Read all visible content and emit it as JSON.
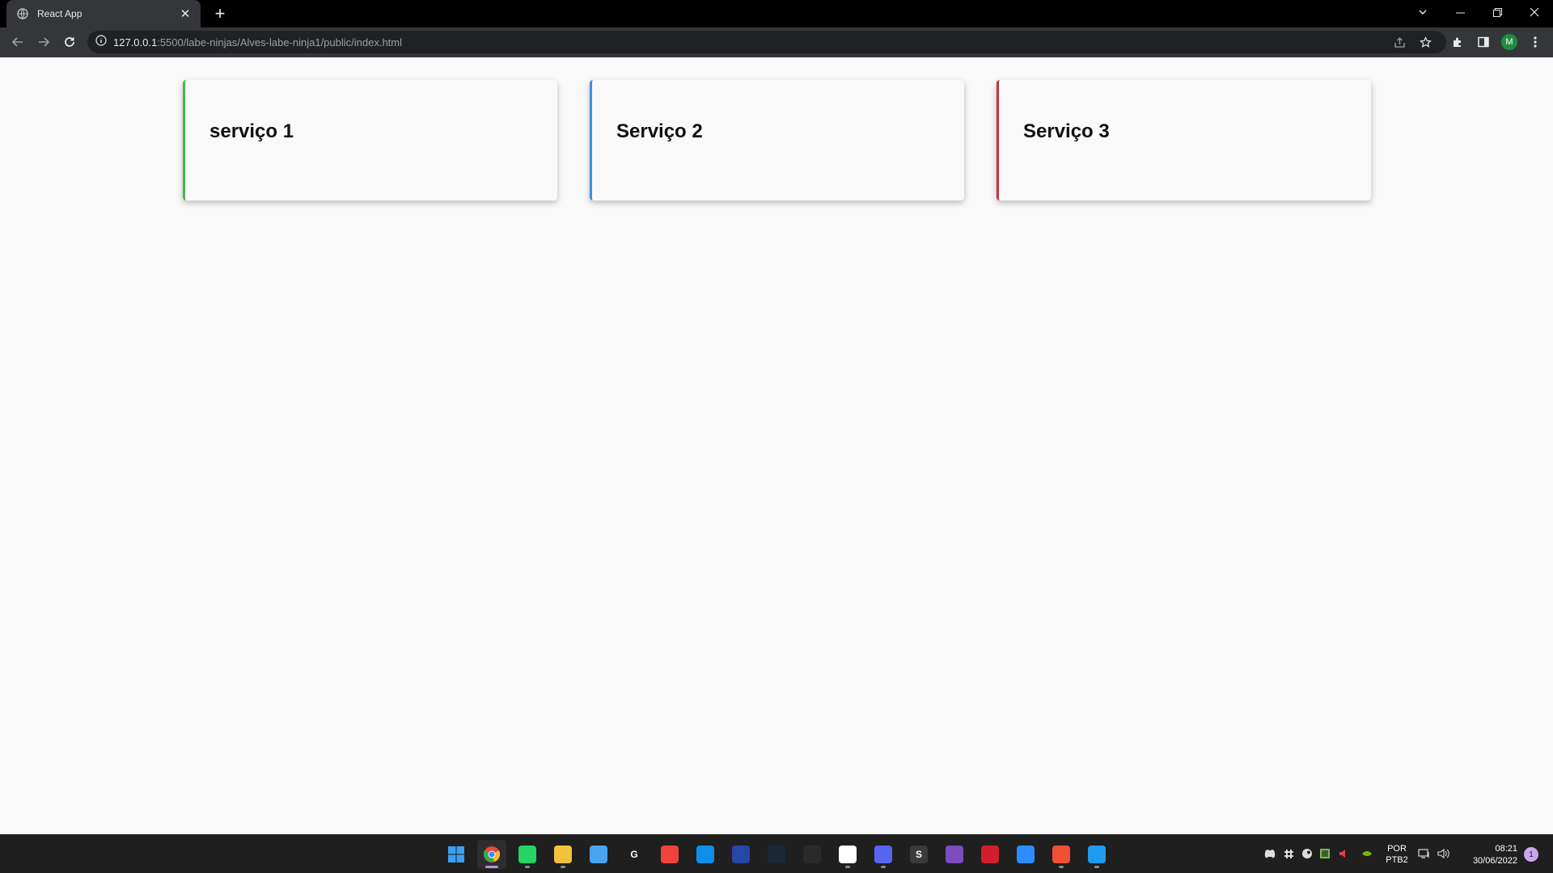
{
  "browser": {
    "tab_title": "React App",
    "url_host": "127.0.0.1",
    "url_rest": ":5500/labe-ninjas/Alves-labe-ninja1/public/index.html",
    "profile_initial": "M"
  },
  "page": {
    "cards": [
      {
        "title": "serviço 1",
        "accent": "#44b849"
      },
      {
        "title": "Serviço 2",
        "accent": "#3d8fe0"
      },
      {
        "title": "Serviço 3",
        "accent": "#c7323c"
      }
    ]
  },
  "taskbar": {
    "apps": [
      {
        "name": "windows-start-icon",
        "color": "#3aa0f3",
        "glyph": ""
      },
      {
        "name": "chrome-icon",
        "color": "#e8453c",
        "glyph": ""
      },
      {
        "name": "whatsapp-icon",
        "color": "#25d366",
        "glyph": ""
      },
      {
        "name": "file-explorer-icon",
        "color": "#f2c33a",
        "glyph": ""
      },
      {
        "name": "widgets-icon",
        "color": "#4aa3f0",
        "glyph": ""
      },
      {
        "name": "logitech-g-icon",
        "color": "#1f1f1f",
        "glyph": "G"
      },
      {
        "name": "anydesk-icon",
        "color": "#ef443b",
        "glyph": ""
      },
      {
        "name": "teamviewer-icon",
        "color": "#0e8ee9",
        "glyph": ""
      },
      {
        "name": "launcher-icon",
        "color": "#2646a8",
        "glyph": ""
      },
      {
        "name": "steam-icon",
        "color": "#1b2838",
        "glyph": ""
      },
      {
        "name": "recorder-icon",
        "color": "#2a2a2a",
        "glyph": ""
      },
      {
        "name": "slack-icon",
        "color": "#ffffff",
        "glyph": ""
      },
      {
        "name": "discord-icon",
        "color": "#5865f2",
        "glyph": ""
      },
      {
        "name": "sublime-text-icon",
        "color": "#3b3b3b",
        "glyph": "S"
      },
      {
        "name": "github-desktop-icon",
        "color": "#7c4dbd",
        "glyph": ""
      },
      {
        "name": "security-icon",
        "color": "#d11f2a",
        "glyph": ""
      },
      {
        "name": "zoom-icon",
        "color": "#2d8cff",
        "glyph": ""
      },
      {
        "name": "git-icon",
        "color": "#f05033",
        "glyph": ""
      },
      {
        "name": "vscode-icon",
        "color": "#1f9cf0",
        "glyph": ""
      }
    ],
    "language": "POR",
    "layout": "PTB2",
    "time": "08:21",
    "date": "30/06/2022",
    "notifications": "1"
  }
}
